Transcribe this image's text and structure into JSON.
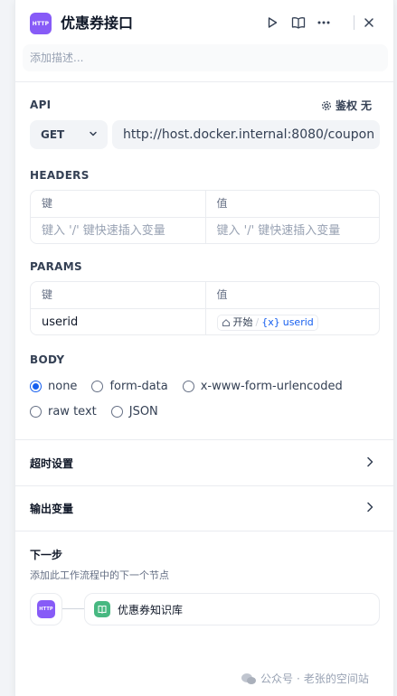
{
  "header": {
    "badge": "HTTP",
    "title": "优惠券接口",
    "description_placeholder": "添加描述..."
  },
  "api": {
    "label": "API",
    "auth_label": "鉴权",
    "auth_value": "无",
    "method": "GET",
    "url": "http://host.docker.internal:8080/coupon"
  },
  "headers": {
    "label": "HEADERS",
    "col_key": "键",
    "col_value": "值",
    "key_placeholder": "键入 '/' 键快速插入变量",
    "value_placeholder": "键入 '/' 键快速插入变量"
  },
  "params": {
    "label": "PARAMS",
    "col_key": "键",
    "col_value": "值",
    "rows": [
      {
        "key": "userid",
        "source_node": "开始",
        "var_icon": "{x}",
        "variable": "userid"
      }
    ]
  },
  "body": {
    "label": "BODY",
    "options": [
      "none",
      "form-data",
      "x-www-form-urlencoded",
      "raw text",
      "JSON"
    ],
    "selected": "none"
  },
  "timeout_settings": {
    "label": "超时设置"
  },
  "output_variables": {
    "label": "输出变量"
  },
  "next_step": {
    "title": "下一步",
    "description": "添加此工作流程中的下一个节点",
    "current_badge": "HTTP",
    "next_node": "优惠券知识库"
  },
  "watermark": {
    "platform": "公众号",
    "separator": "·",
    "account": "老张的空间站"
  },
  "colors": {
    "accent": "#155eef",
    "http_badge": "#875bf7",
    "knowledge_badge": "#47b881"
  }
}
